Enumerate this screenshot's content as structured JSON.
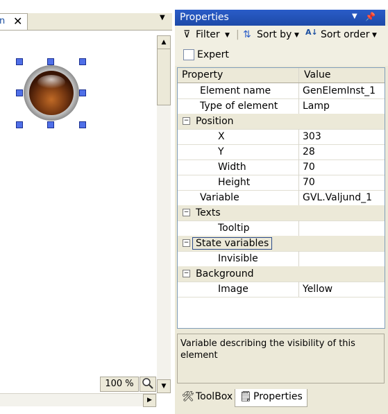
{
  "editor": {
    "tab_label": "n",
    "zoom": "100 %"
  },
  "properties": {
    "title": "Properties",
    "toolbar": {
      "filter": "Filter",
      "sort_by": "Sort by",
      "sort_order": "Sort order"
    },
    "expert_label": "Expert",
    "columns": {
      "property": "Property",
      "value": "Value"
    },
    "rows": [
      {
        "name": "Element name",
        "value": "GenElemInst_1",
        "indent": 1
      },
      {
        "name": "Type of element",
        "value": "Lamp",
        "indent": 1
      },
      {
        "name": "Position",
        "value": "",
        "category": true
      },
      {
        "name": "X",
        "value": "303",
        "indent": 2
      },
      {
        "name": "Y",
        "value": "28",
        "indent": 2
      },
      {
        "name": "Width",
        "value": "70",
        "indent": 2
      },
      {
        "name": "Height",
        "value": "70",
        "indent": 2
      },
      {
        "name": "Variable",
        "value": "GVL.Valjund_1",
        "indent": 1
      },
      {
        "name": "Texts",
        "value": "",
        "category": true
      },
      {
        "name": "Tooltip",
        "value": "",
        "indent": 2
      },
      {
        "name": "State variables",
        "value": "",
        "category": true,
        "selected": true
      },
      {
        "name": "Invisible",
        "value": "",
        "indent": 2
      },
      {
        "name": "Background",
        "value": "",
        "category": true
      },
      {
        "name": "Image",
        "value": "Yellow",
        "indent": 2
      }
    ],
    "description": "Variable describing the visibility of this element",
    "bottom_tabs": {
      "toolbox": "ToolBox",
      "properties": "Properties"
    }
  },
  "colors": {
    "title_bar": "#2a5cc8",
    "lamp": "#7a3a12"
  }
}
